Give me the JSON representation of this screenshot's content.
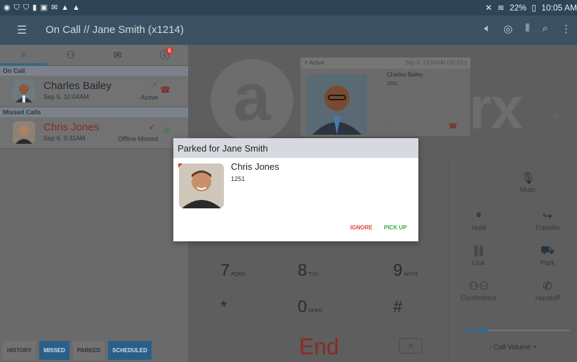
{
  "statusbar": {
    "left_icons": "◉ ⛉ ⛉ ▮ ▣ ✉ ▲ ▲",
    "right": {
      "mute_icon": "⨯",
      "wifi_icon": "wifi",
      "battery": "22%",
      "battery_icon": "battery",
      "time": "10:05 AM"
    }
  },
  "appbar": {
    "title": "On Call // Jane Smith (x1214)",
    "icons": [
      "menu-icon",
      "speaker-icon",
      "location-icon",
      "equalizer-icon",
      "search-icon",
      "more-icon"
    ]
  },
  "left": {
    "tabs": [
      {
        "icon": "list-icon"
      },
      {
        "icon": "contacts-icon"
      },
      {
        "icon": "messages-icon",
        "badge": "6"
      },
      {
        "icon": "info-icon"
      }
    ],
    "on_call_header": "On Call",
    "on_call": {
      "name": "Charles Bailey",
      "time": "Sep 6, 10:04AM",
      "status": "Active"
    },
    "missed_header": "Missed Calls",
    "missed": {
      "name": "Chris Jones",
      "time": "Sep 6, 9:32AM",
      "status": "Offline Missed"
    },
    "bottom_tabs": [
      "HISTORY",
      "MISSED",
      "PARKED",
      "SCHEDULED"
    ]
  },
  "main": {
    "logo_letter": "a",
    "logo_text": "rx",
    "active_card": {
      "label": "Active",
      "timestamp": "Sep 6, 10:04AM (00:33s)",
      "name": "Charles Bailey",
      "ext": "1021"
    },
    "dialpad": [
      {
        "digit": "7",
        "letters": "PQRS"
      },
      {
        "digit": "8",
        "letters": "TUV"
      },
      {
        "digit": "9",
        "letters": "WXYZ"
      },
      {
        "digit": "*",
        "letters": ""
      },
      {
        "digit": "0",
        "letters": "OPER"
      },
      {
        "digit": "#",
        "letters": ""
      }
    ],
    "end_label": "End",
    "controls": {
      "mute": "Mute",
      "hold": "Hold",
      "transfer": "Transfer",
      "link": "Link",
      "park": "Park",
      "conference": "Conference",
      "handoff": "Handoff",
      "volume": "- Call Volume +",
      "volume_level": 0.2
    }
  },
  "dialog": {
    "title": "Parked for Jane Smith",
    "name": "Chris Jones",
    "ext": "1251",
    "ignore": "IGNORE",
    "pickup": "PICK UP"
  }
}
